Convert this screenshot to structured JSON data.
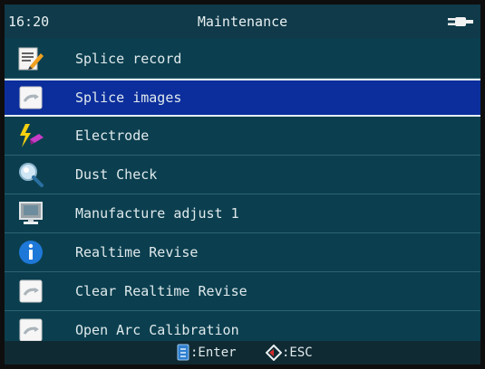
{
  "header": {
    "time": "16:20",
    "title": "Maintenance",
    "power_icon": "plug-icon"
  },
  "menu": {
    "selected_index": 1,
    "items": [
      {
        "label": "Splice record",
        "icon": "notepad-pencil-icon"
      },
      {
        "label": "Splice images",
        "icon": "image-tile-icon"
      },
      {
        "label": "Electrode",
        "icon": "lightning-electrode-icon"
      },
      {
        "label": "Dust Check",
        "icon": "magnifier-icon"
      },
      {
        "label": "Manufacture adjust 1",
        "icon": "monitor-icon"
      },
      {
        "label": "Realtime Revise",
        "icon": "info-icon"
      },
      {
        "label": "Clear Realtime Revise",
        "icon": "image-tile-icon"
      },
      {
        "label": "Open Arc Calibration",
        "icon": "image-tile-icon"
      }
    ]
  },
  "footer": {
    "enter_label": ":Enter",
    "esc_label": ":ESC"
  },
  "colors": {
    "background": "#0b3f4f",
    "selection": "#0c2e9c",
    "text": "#dfe9ec"
  }
}
